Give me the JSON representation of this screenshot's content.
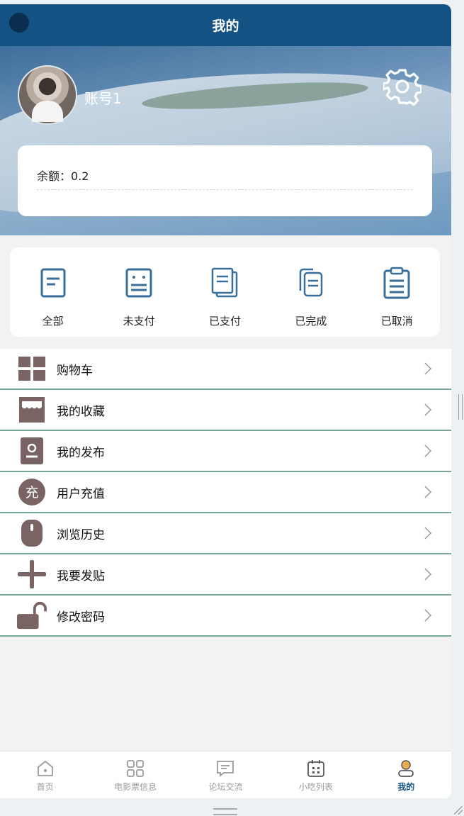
{
  "header": {
    "title": "我的"
  },
  "profile": {
    "account_name": "账号1",
    "balance_label": "余额：",
    "balance_value": "0.2"
  },
  "orders": [
    {
      "label": "全部",
      "icon": "all-orders-icon"
    },
    {
      "label": "未支付",
      "icon": "unpaid-icon"
    },
    {
      "label": "已支付",
      "icon": "paid-icon"
    },
    {
      "label": "已完成",
      "icon": "completed-icon"
    },
    {
      "label": "已取消",
      "icon": "cancelled-icon"
    }
  ],
  "menu": [
    {
      "label": "购物车",
      "icon": "cart-grid-icon"
    },
    {
      "label": "我的收藏",
      "icon": "store-icon"
    },
    {
      "label": "我的发布",
      "icon": "contact-card-icon"
    },
    {
      "label": "用户充值",
      "icon": "recharge-icon",
      "icon_text": "充"
    },
    {
      "label": "浏览历史",
      "icon": "mouse-icon"
    },
    {
      "label": "我要发贴",
      "icon": "plus-icon"
    },
    {
      "label": "修改密码",
      "icon": "unlock-icon"
    }
  ],
  "tabbar": [
    {
      "label": "首页",
      "icon": "home-icon",
      "active": false
    },
    {
      "label": "电影票信息",
      "icon": "grid-icon",
      "active": false
    },
    {
      "label": "论坛交流",
      "icon": "message-icon",
      "active": false
    },
    {
      "label": "小吃列表",
      "icon": "calendar-icon",
      "active": false
    },
    {
      "label": "我的",
      "icon": "profile-icon",
      "active": true
    }
  ],
  "colors": {
    "primary": "#135283",
    "icon_brown": "#7a6463",
    "divider": "#76a69a",
    "accent_gold": "#e8b04a"
  }
}
